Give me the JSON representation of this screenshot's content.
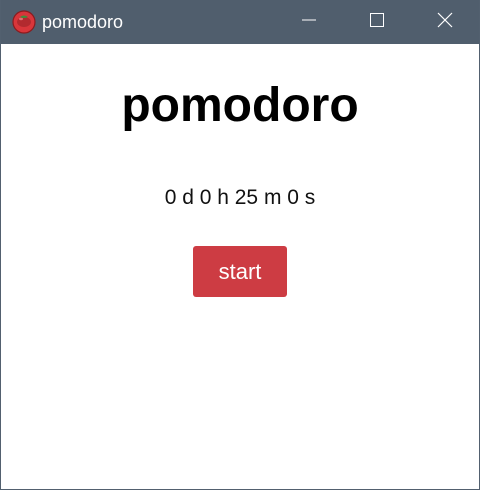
{
  "window": {
    "title": "pomodoro",
    "icons": {
      "app": "tomato-icon",
      "minimize": "minimize-icon",
      "maximize": "maximize-icon",
      "close": "close-icon"
    }
  },
  "main": {
    "heading": "pomodoro",
    "timer": "0 d 0 h 25 m 0 s",
    "start_label": "start"
  },
  "colors": {
    "titlebar": "#505e6d",
    "accent": "#cd3c43",
    "background": "#ffffff"
  }
}
